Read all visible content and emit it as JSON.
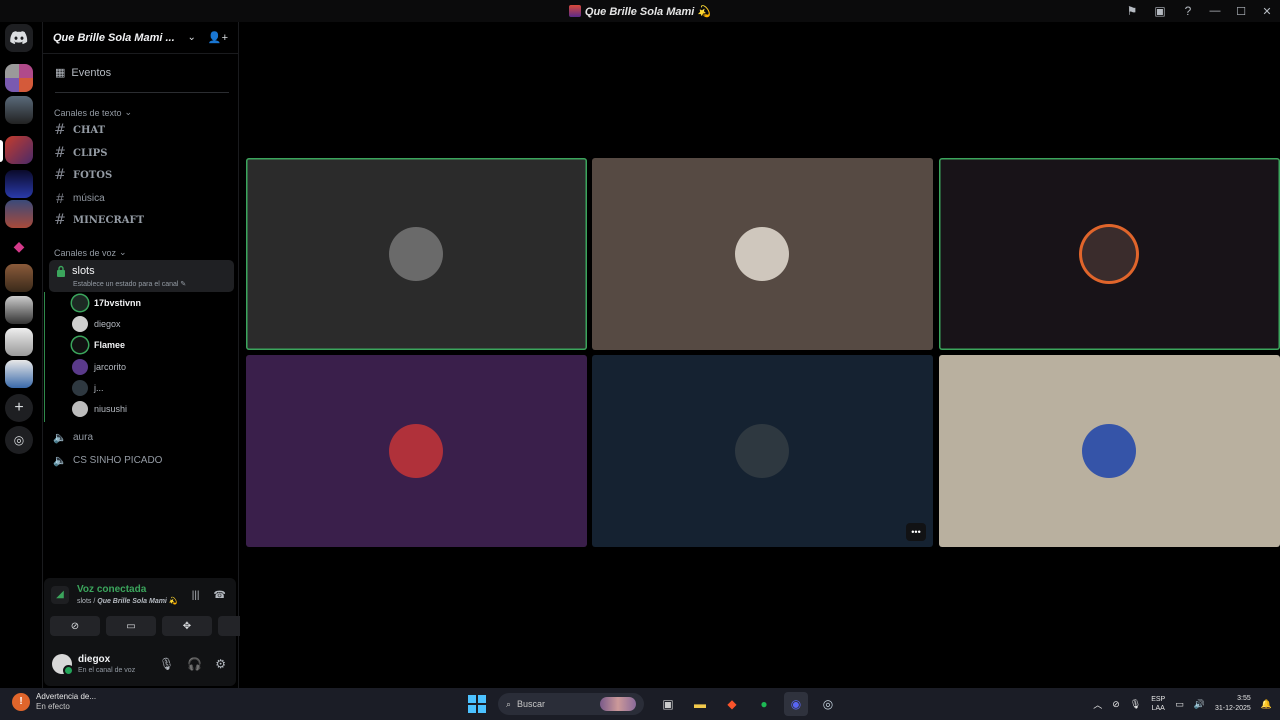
{
  "window": {
    "title": "Que Brille Sola Mami 💫"
  },
  "guild": {
    "name": "Que Brille Sola Mami ..."
  },
  "sidebar": {
    "events_label": "Eventos",
    "text_category": "Canales de texto",
    "text_channels": [
      {
        "name": "CHAT"
      },
      {
        "name": "CLIPS"
      },
      {
        "name": "FOTOS"
      },
      {
        "name": "música"
      },
      {
        "name": "MINECRAFT"
      }
    ],
    "voice_category": "Canales de voz",
    "active_voice": {
      "name": "slots",
      "status_prompt": "Establece un estado para el canal"
    },
    "members": [
      {
        "name": "17bvstivnn",
        "speaking": true
      },
      {
        "name": "diegox",
        "speaking": false
      },
      {
        "name": "Flamee",
        "speaking": true
      },
      {
        "name": "jarcorito",
        "speaking": false
      },
      {
        "name": "j...",
        "speaking": false
      },
      {
        "name": "niusushi",
        "speaking": false
      }
    ],
    "other_voice": [
      {
        "name": "aura"
      },
      {
        "name": "CS SINHO PICADO"
      }
    ]
  },
  "voice_panel": {
    "status": "Voz conectada",
    "channel": "slots /",
    "server": "Que Brille Sola Mami 💫"
  },
  "user": {
    "name": "diegox",
    "status": "En el canal de voz"
  },
  "stage": {
    "tiles": [
      {
        "bg": "#2b2b2b",
        "speaking": true,
        "avatar": "#6a6a6a"
      },
      {
        "bg": "#564a43",
        "speaking": false,
        "avatar": "#cfc7bd"
      },
      {
        "bg": "#181318",
        "speaking": true,
        "avatar": "#3a2c2c"
      },
      {
        "bg": "#3a1f4b",
        "speaking": false,
        "avatar": "#b0313a"
      },
      {
        "bg": "#152231",
        "speaking": false,
        "avatar": "#2e3840"
      },
      {
        "bg": "#b9b09f",
        "speaking": false,
        "avatar": "#3554a8"
      }
    ]
  },
  "taskbar": {
    "warning_title": "Advertencia de...",
    "warning_sub": "En efecto",
    "search_placeholder": "Buscar",
    "lang_1": "ESP",
    "lang_2": "LAA",
    "time": "3:55",
    "date": "31-12-2025"
  },
  "colors": {
    "speaking": "#3ba55c",
    "connected": "#3ba55c",
    "accent": "#5865f2"
  }
}
